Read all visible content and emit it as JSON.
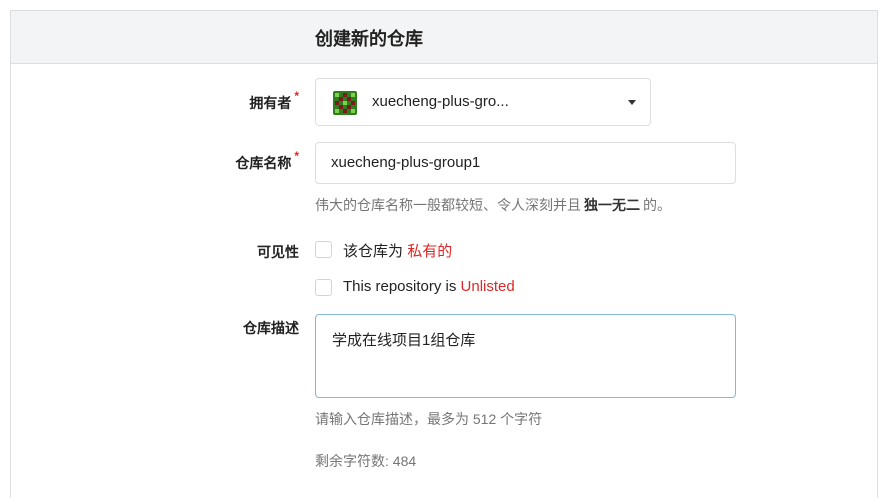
{
  "header": {
    "title": "创建新的仓库"
  },
  "owner": {
    "label": "拥有者",
    "required_mark": "*",
    "avatar_icon": "identicon-avatar",
    "selected": "xuecheng-plus-gro..."
  },
  "repo_name": {
    "label": "仓库名称",
    "required_mark": "*",
    "value": "xuecheng-plus-group1",
    "help_prefix": "伟大的仓库名称一般都较短、令人深刻并且",
    "help_emphasis": "独一无二",
    "help_suffix": "的。"
  },
  "visibility": {
    "label": "可见性",
    "private_prefix": "该仓库为",
    "private_highlight": "私有的",
    "private_checked": false,
    "unlisted_prefix": "This repository is",
    "unlisted_highlight": "Unlisted",
    "unlisted_checked": false
  },
  "description": {
    "label": "仓库描述",
    "value": "学成在线项目1组仓库",
    "help": "请输入仓库描述，最多为 512 个字符",
    "remaining": "剩余字符数: 484"
  },
  "colors": {
    "highlight_red": "#db2828",
    "focus_border": "#85b7d9",
    "header_bg": "#f3f4f5"
  }
}
